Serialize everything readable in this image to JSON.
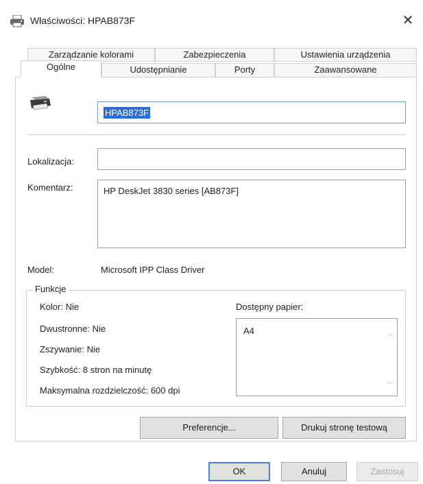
{
  "window": {
    "title": "Właściwości: HPAB873F",
    "close_glyph": "✕"
  },
  "tabs": {
    "row_back": [
      "Zarządzanie kolorami",
      "Zabezpieczenia",
      "Ustawienia urządzenia"
    ],
    "row_front": [
      "Ogólne",
      "Udostępnianie",
      "Porty",
      "Zaawansowane"
    ],
    "active": "Ogólne"
  },
  "general": {
    "printer_name": "HPAB873F",
    "location_label": "Lokalizacja:",
    "location_value": "",
    "comment_label": "Komentarz:",
    "comment_value": "HP DeskJet 3830 series [AB873F]",
    "model_label": "Model:",
    "model_value": "Microsoft IPP Class Driver"
  },
  "features": {
    "title": "Funkcje",
    "color": "Kolor: Nie",
    "duplex": "Dwustronne: Nie",
    "staple": "Zszywanie: Nie",
    "speed": "Szybkość: 8 stron na minutę",
    "resolution": "Maksymalna rozdzielczość: 600  dpi",
    "paper_label": "Dostępny papier:",
    "paper_items": [
      "A4"
    ]
  },
  "buttons": {
    "preferences": "Preferencje...",
    "print_test": "Drukuj stronę testową",
    "ok": "OK",
    "cancel": "Anuluj",
    "apply": "Zastosuj"
  }
}
